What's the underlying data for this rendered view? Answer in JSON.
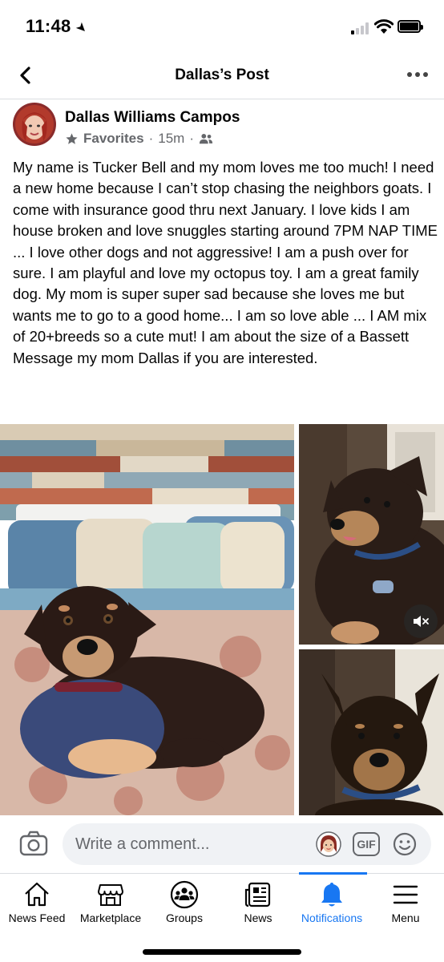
{
  "status_bar": {
    "time": "11:48"
  },
  "header": {
    "title": "Dallas’s Post"
  },
  "post": {
    "author": "Dallas Williams Campos",
    "audience": "Favorites",
    "time": "15m",
    "text": "My name is Tucker Bell and my mom loves me too much! I need a new home because I can’t stop chasing the neighbors goats.  I come with insurance good thru  next January.  I love kids I am house broken and love snuggles starting around 7PM  NAP TIME ... I love other dogs and not aggressive! I am a push over for sure.  I am playful and love my octopus toy.  I am a great family dog.  My mom is super super sad because she loves me but wants me to go to a good home... I am so love able ... I AM mix of 20+breeds so a cute mut! I am about the size of a Bassett\n Message my mom Dallas if you are interested."
  },
  "comment_bar": {
    "placeholder": "Write a comment...",
    "gif_label": "GIF"
  },
  "bottom_nav": {
    "items": [
      {
        "label": "News Feed",
        "icon": "home-icon"
      },
      {
        "label": "Marketplace",
        "icon": "shop-icon"
      },
      {
        "label": "Groups",
        "icon": "groups-icon"
      },
      {
        "label": "News",
        "icon": "news-icon"
      },
      {
        "label": "Notifications",
        "icon": "bell-icon",
        "active": true
      },
      {
        "label": "Menu",
        "icon": "menu-icon"
      }
    ]
  },
  "colors": {
    "accent": "#1877f2",
    "secondary_text": "#65676b",
    "comment_bg": "#f0f2f5"
  }
}
